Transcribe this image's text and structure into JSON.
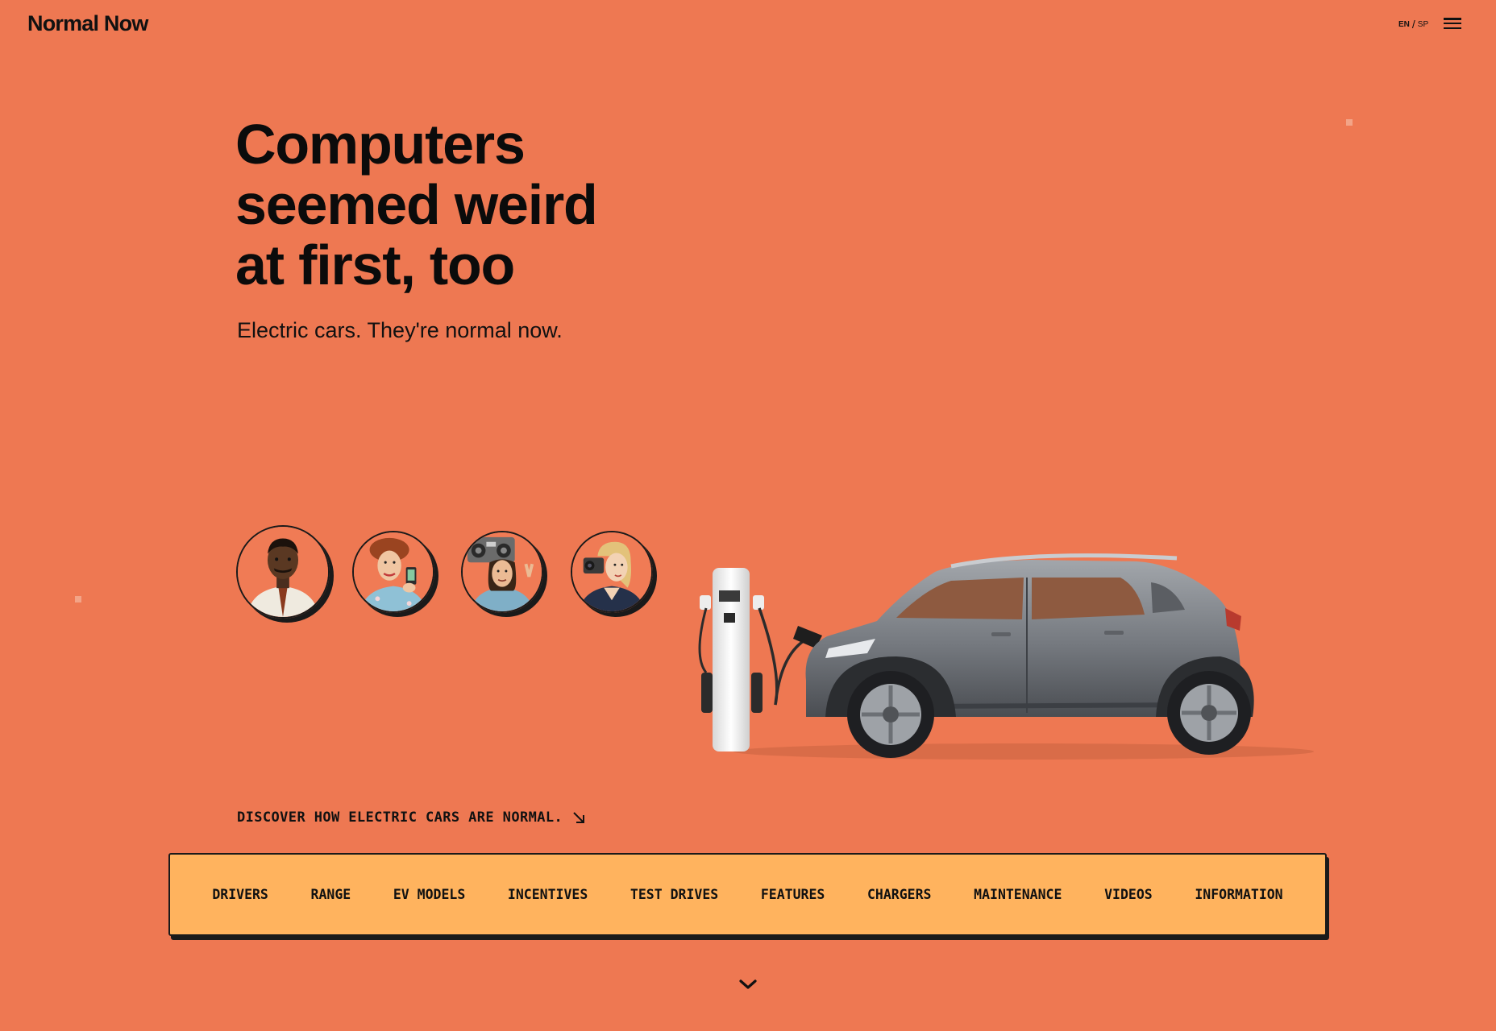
{
  "header": {
    "logo": "Normal Now",
    "lang_active": "EN",
    "lang_separator": "/",
    "lang_other": "SP",
    "menu_icon": "hamburger-menu-icon"
  },
  "hero": {
    "headline_line1": "Computers",
    "headline_line2": "seemed weird",
    "headline_line3": "at first, too",
    "subheadline": "Electric cars. They're normal now."
  },
  "avatars": [
    {
      "subject": "man in shirt and tie"
    },
    {
      "subject": "woman holding phone"
    },
    {
      "subject": "man with boombox"
    },
    {
      "subject": "woman with camcorder"
    }
  ],
  "illustration": {
    "subject": "gray electric SUV plugged into charging station"
  },
  "discover": {
    "label": "DISCOVER HOW ELECTRIC CARS ARE NORMAL.",
    "icon": "arrow-down-right-icon"
  },
  "nav": {
    "items": [
      "DRIVERS",
      "RANGE",
      "EV MODELS",
      "INCENTIVES",
      "TEST DRIVES",
      "FEATURES",
      "CHARGERS",
      "MAINTENANCE",
      "VIDEOS",
      "INFORMATION"
    ]
  },
  "scroll_icon": "chevron-down-icon",
  "colors": {
    "background": "#EE7852",
    "nav_background": "#FFB35E",
    "text": "#0b0b0b"
  }
}
